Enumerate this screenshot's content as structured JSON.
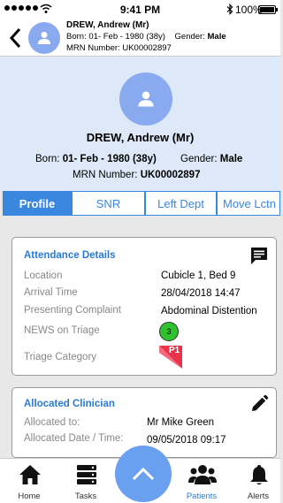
{
  "status_bar": {
    "time": "9:41 PM",
    "battery": "100%"
  },
  "header": {
    "name": "DREW, Andrew (Mr)",
    "born_label": "Born:",
    "born_value": "01- Feb - 1980 (38y)",
    "gender_label": "Gender:",
    "gender_value": "Male",
    "mrn_label": "MRN Number:",
    "mrn_value": "UK00002897"
  },
  "banner": {
    "name": "DREW, Andrew (Mr)",
    "born_label": "Born:",
    "born_value": "01- Feb - 1980 (38y)",
    "gender_label": "Gender:",
    "gender_value": "Male",
    "mrn_label": "MRN Number:",
    "mrn_value": "UK00002897"
  },
  "tabs": [
    {
      "label": "Profile",
      "active": true
    },
    {
      "label": "SNR"
    },
    {
      "label": "Left Dept"
    },
    {
      "label": "Move Lctn"
    }
  ],
  "attendance": {
    "title": "Attendance Details",
    "location_label": "Location",
    "location_value": "Cubicle 1, Bed 9",
    "arrival_label": "Arrival Time",
    "arrival_value": "28/04/2018 14:47",
    "complaint_label": "Presenting Complaint",
    "complaint_value": "Abdominal Distention",
    "news_label": "NEWS on Triage",
    "news_value": "3",
    "triage_label": "Triage Category",
    "triage_value": "P1"
  },
  "clinician": {
    "title": "Allocated Clinician",
    "allocated_label": "Allocated to:",
    "allocated_value": "Mr Mike Green",
    "date_label": "Allocated Date / Time:",
    "date_value": "09/05/2018 09:17"
  },
  "nav": {
    "home": "Home",
    "tasks": "Tasks",
    "patients": "Patients",
    "alerts": "Alerts"
  },
  "colors": {
    "accent": "#3a87e0",
    "banner": "#dde9f8",
    "avatar": "#8aaaf0",
    "news_green": "#2ec22e",
    "triage_red": "#e8334a"
  }
}
